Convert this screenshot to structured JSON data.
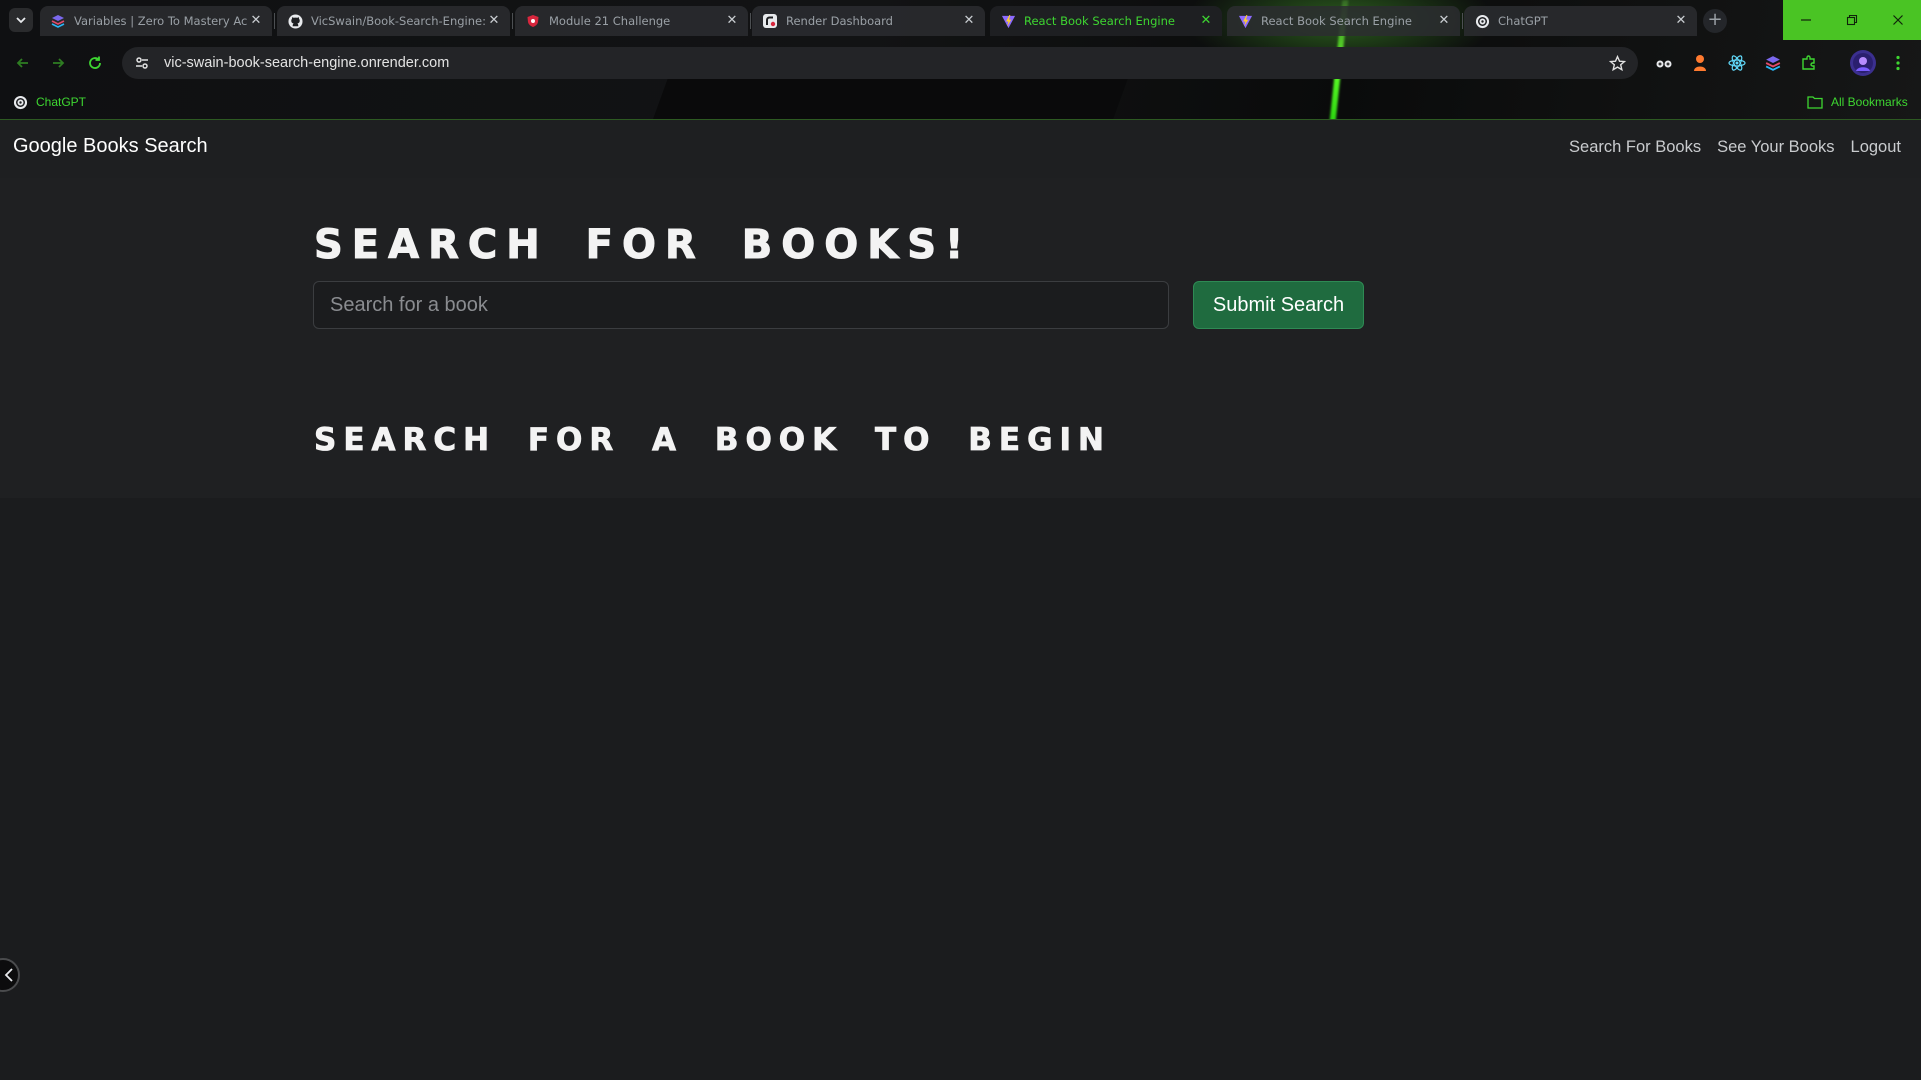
{
  "browser": {
    "tabs": [
      {
        "title": "Variables | Zero To Mastery Aca",
        "icon": "ztm-logo-icon",
        "active": false
      },
      {
        "title": "VicSwain/Book-Search-Engine:",
        "icon": "github-icon",
        "active": false
      },
      {
        "title": "Module 21 Challenge",
        "icon": "canvas-shield-icon",
        "active": false
      },
      {
        "title": "Render Dashboard",
        "icon": "render-icon",
        "active": false
      },
      {
        "title": "React Book Search Engine",
        "icon": "vite-icon",
        "active": true
      },
      {
        "title": "React Book Search Engine",
        "icon": "vite-icon",
        "active": false
      },
      {
        "title": "ChatGPT",
        "icon": "chatgpt-icon",
        "active": false
      }
    ],
    "url": "vic-swain-book-search-engine.onrender.com",
    "bookmarks": {
      "items": [
        {
          "label": "ChatGPT",
          "icon": "chatgpt-icon"
        }
      ],
      "all_bookmarks": "All Bookmarks"
    },
    "accent_color": "#3ed631"
  },
  "app": {
    "brand": "Google Books Search",
    "nav": {
      "search": "Search For Books",
      "saved": "See Your Books",
      "logout": "Logout"
    },
    "hero": {
      "title": "SEARCH FOR BOOKS!",
      "input_placeholder": "Search for a book",
      "input_value": "",
      "submit_label": "Submit Search"
    },
    "results": {
      "heading": "SEARCH FOR A BOOK TO BEGIN"
    },
    "colors": {
      "background": "#1b1c1e",
      "button": "#1f6b3f"
    }
  }
}
